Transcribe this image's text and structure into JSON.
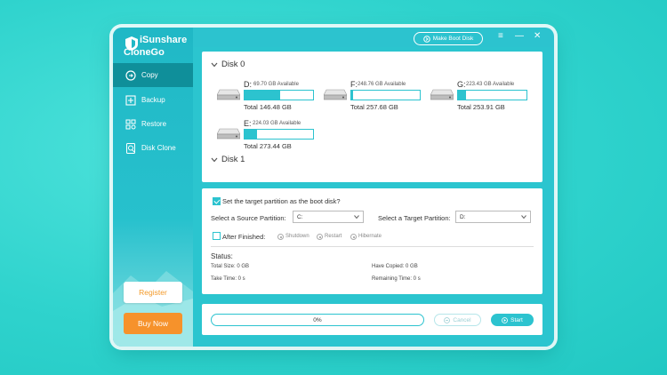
{
  "app": {
    "name_line1": "iSunshare",
    "name_line2": "CloneGo",
    "accent": "#2cc3cf",
    "brand_orange": "#f6922b"
  },
  "titlebar": {
    "boot_button_label": "Make Boot Disk",
    "menu_icon": "menu-icon",
    "minimize_icon": "minimize-icon",
    "close_icon": "close-icon"
  },
  "sidebar": {
    "items": [
      {
        "label": "Copy",
        "icon": "copy-icon",
        "active": true
      },
      {
        "label": "Backup",
        "icon": "backup-icon",
        "active": false
      },
      {
        "label": "Restore",
        "icon": "restore-icon",
        "active": false
      },
      {
        "label": "Disk Clone",
        "icon": "disk-clone-icon",
        "active": false
      }
    ],
    "register_label": "Register",
    "buy_label": "Buy Now"
  },
  "disks": {
    "disk0_label": "Disk 0",
    "disk1_label": "Disk 1",
    "partitions": [
      {
        "letter": "D:",
        "available": "69.70 GB Available",
        "total": "Total 146.48 GB",
        "used_fraction": 0.52
      },
      {
        "letter": "F:",
        "available": "248.76 GB Available",
        "total": "Total 257.68 GB",
        "used_fraction": 0.03
      },
      {
        "letter": "G:",
        "available": "223.43 GB Available",
        "total": "Total 253.91 GB",
        "used_fraction": 0.12
      },
      {
        "letter": "E:",
        "available": "224.03 GB Available",
        "total": "Total 273.44 GB",
        "used_fraction": 0.18
      }
    ]
  },
  "options": {
    "boot_disk_label": "Set the target partition as the boot disk?",
    "boot_disk_checked": true,
    "source_label": "Select a Source Partition:",
    "source_value": "C:",
    "target_label": "Select a Target Partition:",
    "target_value": "D:",
    "after_finished_label": "After Finished:",
    "after_finished_checked": false,
    "radio_shutdown": "Shutdown",
    "radio_restart": "Restart",
    "radio_hibernate": "Hibernate"
  },
  "status": {
    "title": "Status:",
    "total_size": "Total Size: 0 GB",
    "have_copied": "Have Copied: 0 GB",
    "take_time": "Take Time: 0 s",
    "remaining_time": "Remaining Time: 0 s"
  },
  "footer": {
    "progress_text": "0%",
    "progress_value": 0,
    "cancel_label": "Cancel",
    "start_label": "Start"
  }
}
